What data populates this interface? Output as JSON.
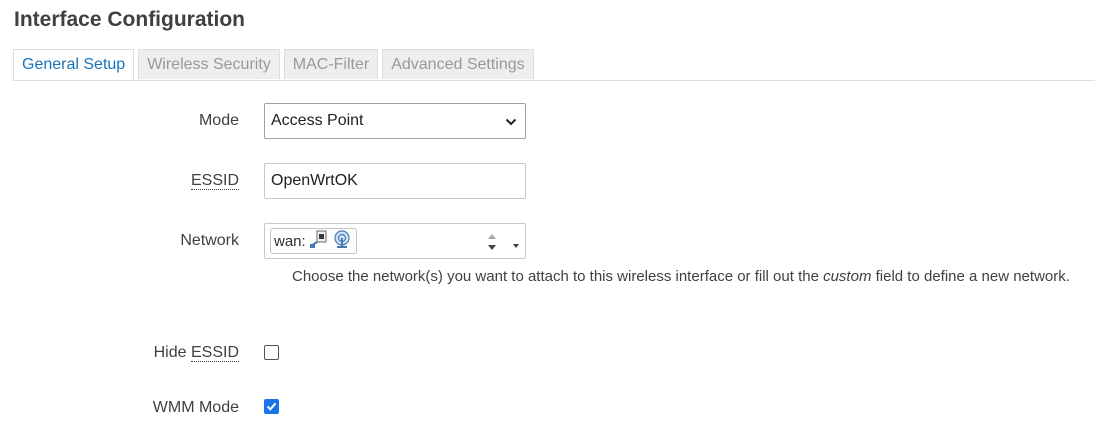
{
  "page": {
    "title": "Interface Configuration"
  },
  "tabs": [
    {
      "label": "General Setup",
      "active": true
    },
    {
      "label": "Wireless Security",
      "active": false
    },
    {
      "label": "MAC-Filter",
      "active": false
    },
    {
      "label": "Advanced Settings",
      "active": false
    }
  ],
  "form": {
    "mode": {
      "label": "Mode",
      "value": "Access Point"
    },
    "essid": {
      "label": "ESSID",
      "value": "OpenWrtOK"
    },
    "network": {
      "label": "Network",
      "selected": "wan:",
      "icons": [
        "ethernet-port-icon",
        "wireless-network-icon"
      ],
      "help_before": "Choose the network(s) you want to attach to this wireless interface or fill out the ",
      "help_em": "custom",
      "help_after": " field to define a new network."
    },
    "hide_essid": {
      "label_prefix": "Hide ",
      "label_abbr": "ESSID",
      "checked": false
    },
    "wmm_mode": {
      "label": "WMM Mode",
      "checked": true
    }
  },
  "colors": {
    "accent": "#1a73b8",
    "checkbox_checked": "#1a73e8"
  }
}
